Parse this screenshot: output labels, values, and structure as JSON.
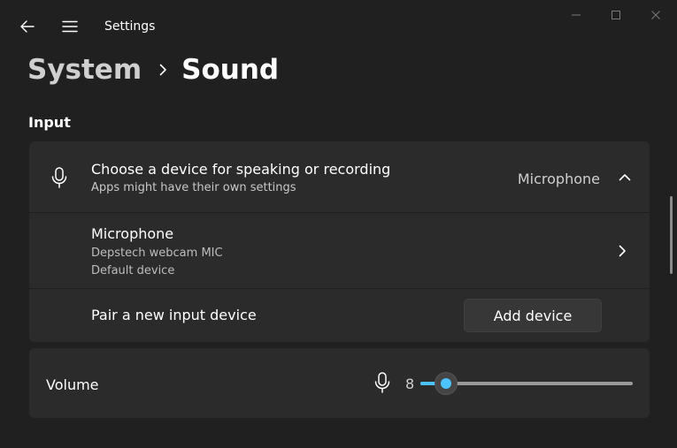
{
  "window": {
    "title": "Settings"
  },
  "breadcrumb": {
    "parent": "System",
    "current": "Sound"
  },
  "section": {
    "title": "Input"
  },
  "input_device": {
    "title": "Choose a device for speaking or recording",
    "subtitle": "Apps might have their own settings",
    "selected_value": "Microphone"
  },
  "microphone": {
    "title": "Microphone",
    "device_name": "Depstech webcam MIC",
    "status": "Default device"
  },
  "pair_device": {
    "label": "Pair a new input device",
    "button_label": "Add device"
  },
  "volume": {
    "label": "Volume",
    "value": "8",
    "level": 0.08
  },
  "colors": {
    "accent": "#4cc2ff",
    "background": "#202020",
    "card": "#2b2b2b"
  },
  "icons": {
    "back": "back-arrow-icon",
    "menu": "hamburger-menu-icon",
    "minimize": "minimize-icon",
    "maximize": "maximize-icon",
    "close": "close-icon",
    "mic": "microphone-icon",
    "chevron_up": "chevron-up-icon",
    "chevron_right": "chevron-right-icon"
  }
}
